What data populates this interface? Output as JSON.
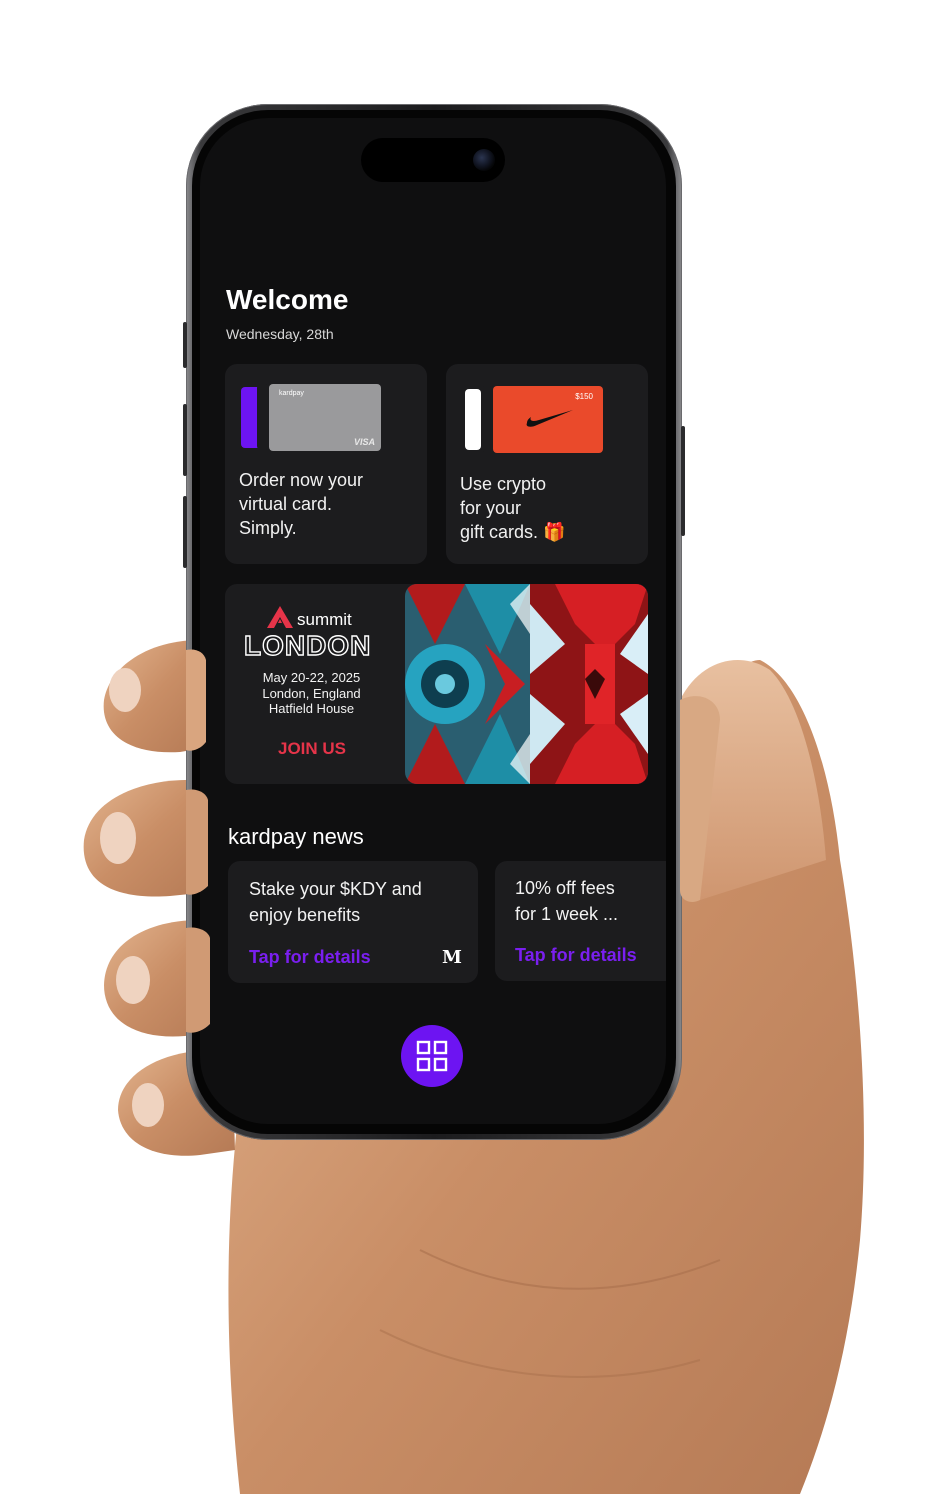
{
  "header": {
    "title": "Welcome",
    "date": "Wednesday, 28th"
  },
  "promo_tiles": [
    {
      "text": "Order now your\nvirtual card.\nSimply.",
      "card_brand": "kardpay",
      "card_network": "VISA",
      "icon": "virtual-card-icon"
    },
    {
      "text": "Use crypto\nfor your\ngift cards. 🎁",
      "gift_amount": "$150",
      "icon": "gift-card-icon"
    }
  ],
  "event_banner": {
    "brand": "summit",
    "city": "LONDON",
    "dates": "May 20-22, 2025",
    "location": "London, England",
    "venue": "Hatfield House",
    "cta": "JOIN US",
    "accent_color": "#e63449"
  },
  "news": {
    "section_title": "kardpay news",
    "items": [
      {
        "text": "Stake your $KDY and\nenjoy benefits",
        "link": "Tap for details",
        "source_mark": "M"
      },
      {
        "text": "10% off fees\nfor 1 week ...",
        "link": "Tap for details"
      }
    ]
  },
  "bottom_bar": {
    "menu_icon": "grid-menu-icon",
    "accent_color": "#6d14f2"
  }
}
